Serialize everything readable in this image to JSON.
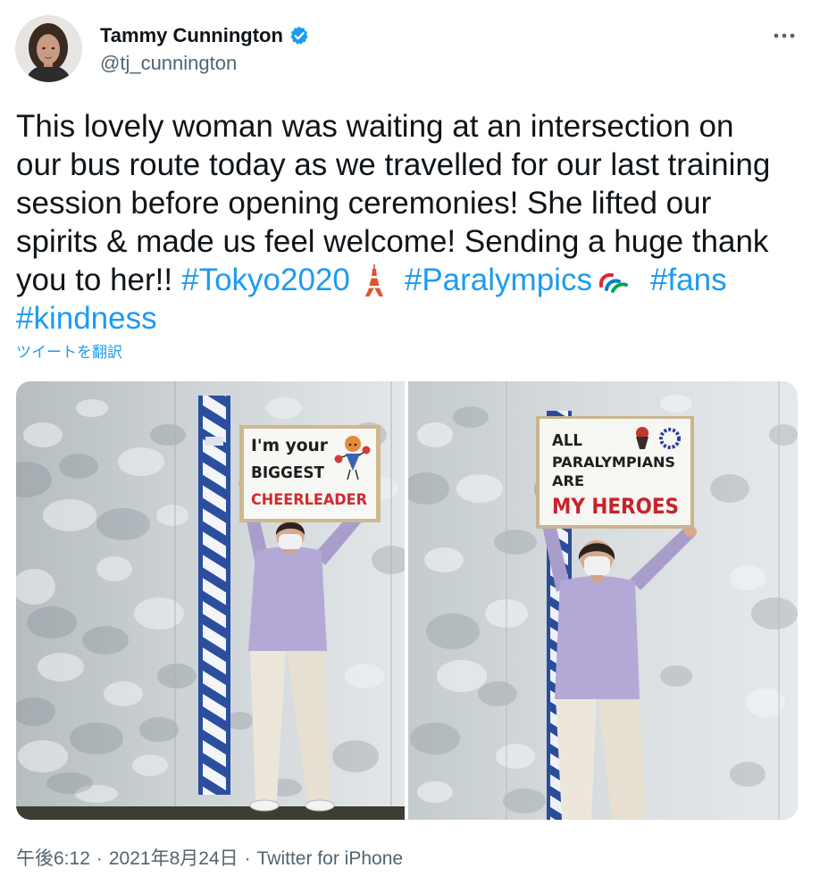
{
  "author": {
    "name": "Tammy Cunnington",
    "handle": "@tj_cunnington",
    "verified": true
  },
  "tweet": {
    "lines": [
      "This lovely woman was waiting at an intersection on",
      "our bus route today as we travelled for our last training",
      "session before opening ceremonies! She lifted our",
      "spirits & made us feel welcome! Sending a huge thank",
      "you to her!!"
    ],
    "hashtags": [
      "#Tokyo2020",
      "#Paralympics",
      "#fans",
      "#kindness"
    ],
    "emoji": [
      "tokyo-tower-icon",
      "paralympics-agitos-icon"
    ],
    "translate_label": "ツイートを翻訳"
  },
  "media": {
    "photos": [
      {
        "sign_lines": [
          "I'm your",
          "BIGGEST",
          "CHEERLEADER"
        ]
      },
      {
        "sign_lines": [
          "ALL",
          "PARALYMPIANS",
          "ARE",
          "MY HEROES"
        ]
      }
    ]
  },
  "footer": {
    "time": "午後6:12",
    "separator": "·",
    "date": "2021年8月24日",
    "source": "Twitter for iPhone"
  },
  "icons": {
    "verified": "verified-badge-icon",
    "more": "more-icon",
    "avatar": "avatar"
  },
  "colors": {
    "text": "#0f1419",
    "secondary": "#536471",
    "link": "#1d9bf0",
    "verified": "#1d9bf0",
    "sign_red": "#d12a2f"
  }
}
